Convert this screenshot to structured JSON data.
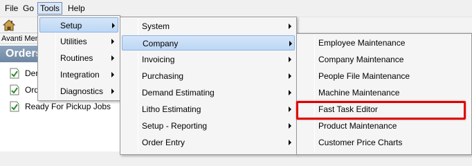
{
  "menubar": {
    "file": "File",
    "go": "Go",
    "tools": "Tools",
    "help": "Help"
  },
  "toolbar": {
    "home_icon": "home-icon"
  },
  "left_panel": {
    "pane_title": "Avanti Menu",
    "section_title": "Orders",
    "items": [
      {
        "label": "Demand Estimates"
      },
      {
        "label": "Order Entry"
      },
      {
        "label": "Ready For Pickup Jobs"
      }
    ]
  },
  "tools_menu": {
    "items": [
      {
        "label": "Setup"
      },
      {
        "label": "Utilities"
      },
      {
        "label": "Routines"
      },
      {
        "label": "Integration"
      },
      {
        "label": "Diagnostics"
      }
    ]
  },
  "setup_menu": {
    "items": [
      {
        "label": "System"
      },
      {
        "label": "Company"
      },
      {
        "label": "Invoicing"
      },
      {
        "label": "Purchasing"
      },
      {
        "label": "Demand Estimating"
      },
      {
        "label": "Litho Estimating"
      },
      {
        "label": "Setup - Reporting"
      },
      {
        "label": "Order Entry"
      }
    ]
  },
  "company_menu": {
    "items": [
      {
        "label": "Employee Maintenance"
      },
      {
        "label": "Company Maintenance"
      },
      {
        "label": "People File Maintenance"
      },
      {
        "label": "Machine Maintenance"
      },
      {
        "label": "Fast Task Editor"
      },
      {
        "label": "Product Maintenance"
      },
      {
        "label": "Customer Price Charts"
      }
    ]
  },
  "colors": {
    "highlight_callout": "#e00000",
    "menu_highlight": "#cde2f8",
    "section_header": "#7890ab"
  }
}
